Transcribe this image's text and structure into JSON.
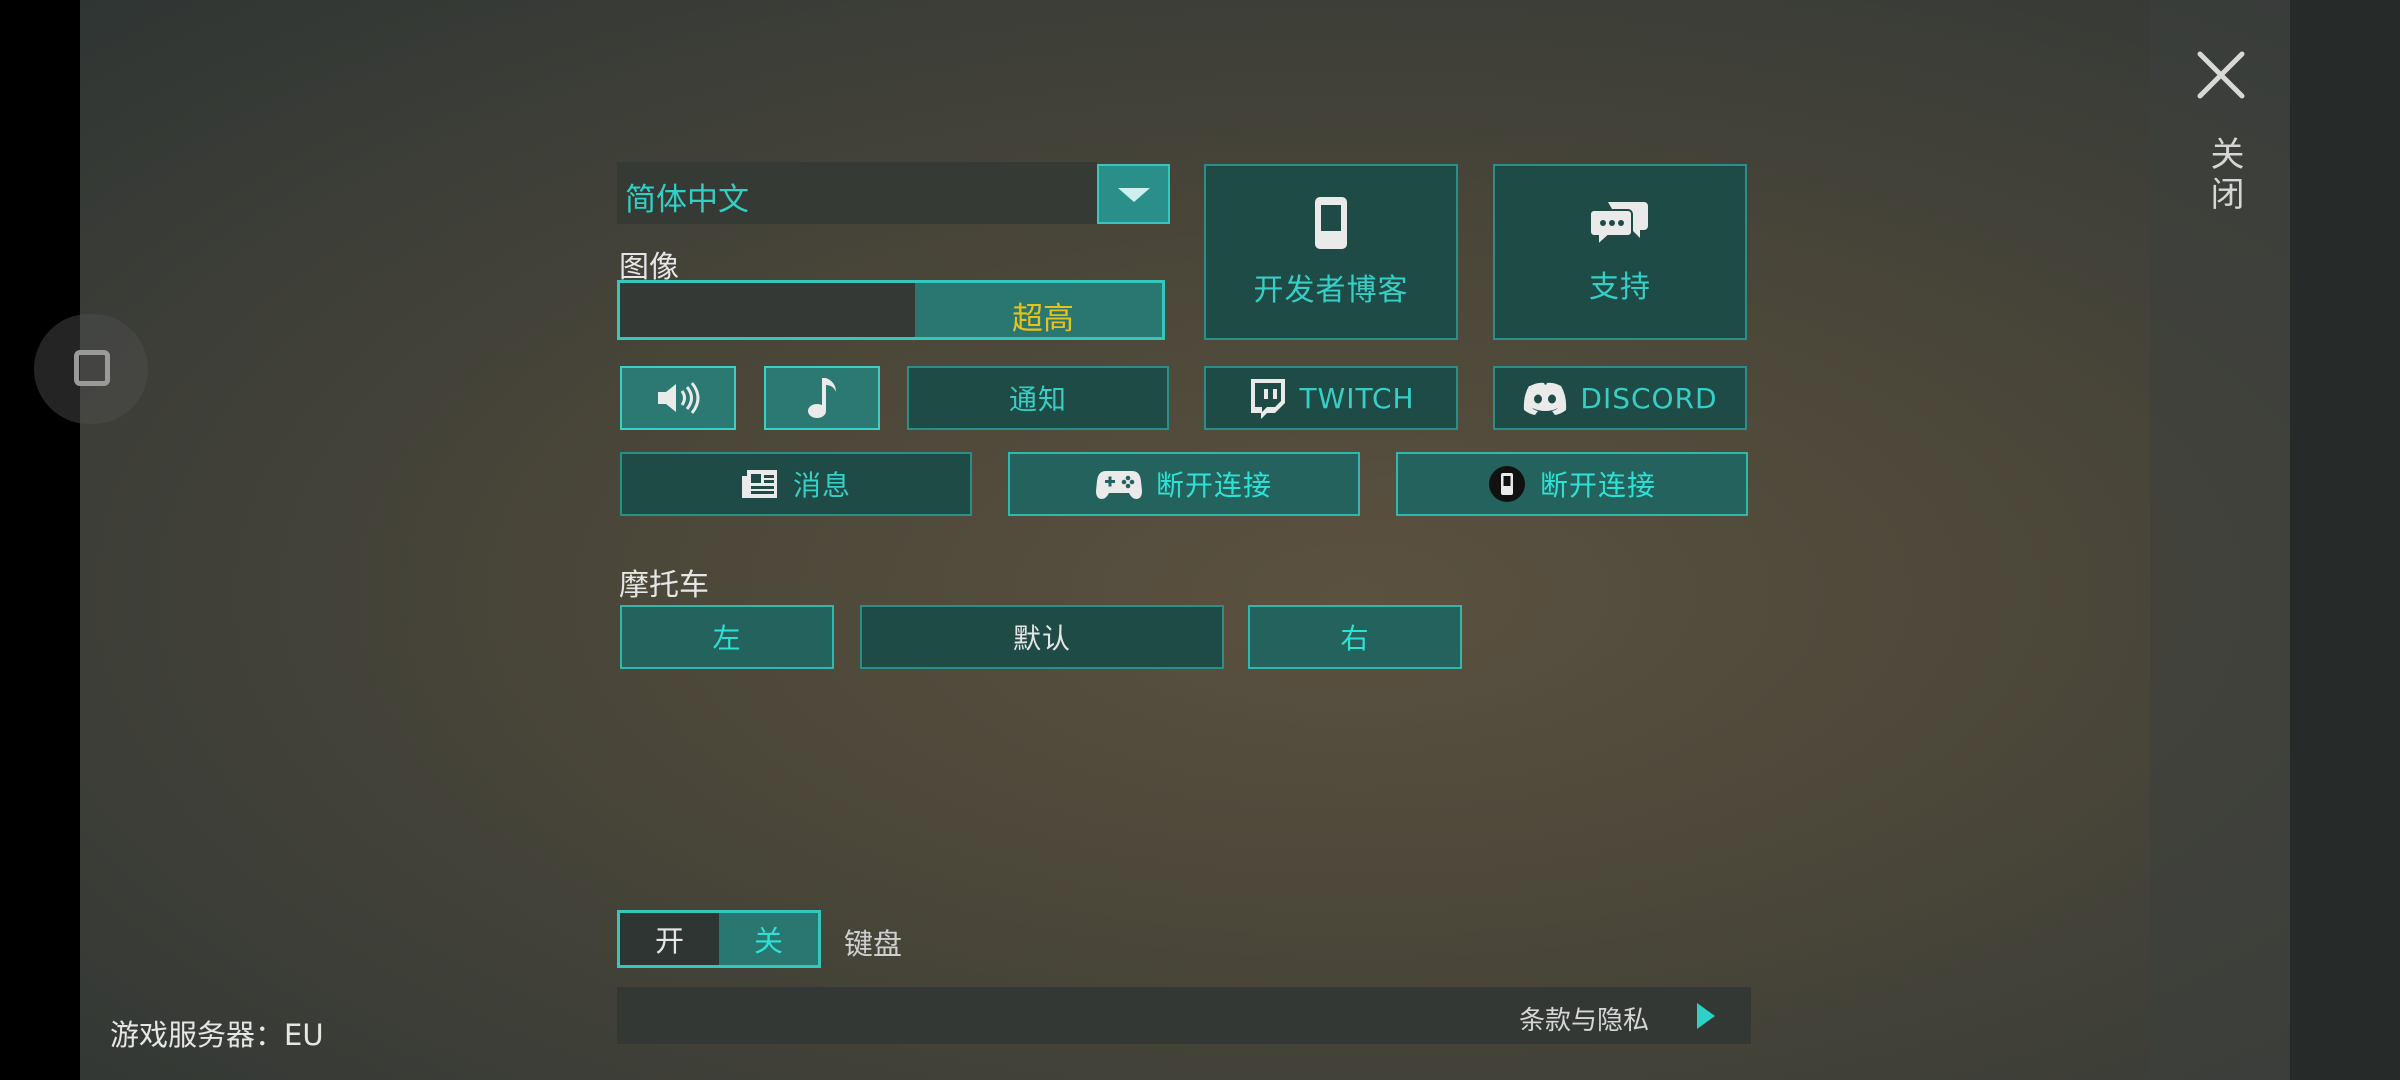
{
  "language": {
    "selected": "简体中文"
  },
  "graphics": {
    "label": "图像",
    "value": "超高",
    "level_fraction": 1.0
  },
  "links": {
    "dev_blog": "开发者博客",
    "support": "支持",
    "twitch": "TWITCH",
    "discord": "DISCORD"
  },
  "toggles": {
    "notify": "通知"
  },
  "row3": {
    "news": "消息",
    "gamepad_disconnect": "断开连接",
    "phone_disconnect": "断开连接"
  },
  "motorcycle": {
    "label": "摩托车",
    "left": "左",
    "default": "默认",
    "right": "右"
  },
  "keyboard": {
    "on": "开",
    "off": "关",
    "label": "键盘"
  },
  "footer": {
    "terms": "条款与隐私"
  },
  "server": {
    "text": "游戏服务器：EU"
  },
  "close": {
    "label": "关闭"
  },
  "colors": {
    "accent": "#2fd0c7",
    "highlight": "#e8c21a",
    "panel": "#24635d"
  }
}
